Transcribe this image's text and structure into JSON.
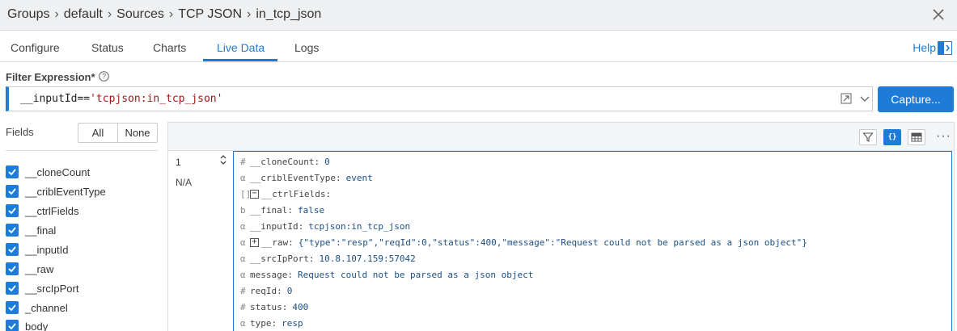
{
  "breadcrumb": [
    "Groups",
    "default",
    "Sources",
    "TCP JSON",
    "in_tcp_json"
  ],
  "tabs": [
    "Configure",
    "Status",
    "Charts",
    "Live Data",
    "Logs"
  ],
  "active_tab": "Live Data",
  "help_label": "Help",
  "filter": {
    "label": "Filter Expression*",
    "key": "__inputId==",
    "value": "'tcpjson:in_tcp_json'"
  },
  "capture_label": "Capture...",
  "fields_panel": {
    "title": "Fields",
    "all_label": "All",
    "none_label": "None",
    "items": [
      "__cloneCount",
      "__criblEventType",
      "__ctrlFields",
      "__final",
      "__inputId",
      "__raw",
      "__srcIpPort",
      "_channel",
      "body"
    ]
  },
  "event": {
    "index": "1",
    "time": "N/A",
    "fields": [
      {
        "type": "#",
        "key": "__cloneCount",
        "value": "0"
      },
      {
        "type": "α",
        "key": "__criblEventType",
        "value": "event"
      },
      {
        "type": "[]",
        "key": "__ctrlFields",
        "value": "",
        "toggle": "−"
      },
      {
        "type": "b",
        "key": "__final",
        "value": "false"
      },
      {
        "type": "α",
        "key": "__inputId",
        "value": "tcpjson:in_tcp_json"
      },
      {
        "type": "α",
        "key": "__raw",
        "value": "{\"type\":\"resp\",\"reqId\":0,\"status\":400,\"message\":\"Request could not be parsed as a json object\"}",
        "toggle": "+"
      },
      {
        "type": "α",
        "key": "__srcIpPort",
        "value": "10.8.107.159:57042"
      },
      {
        "type": "α",
        "key": "message",
        "value": "Request could not be parsed as a json object"
      },
      {
        "type": "#",
        "key": "reqId",
        "value": "0"
      },
      {
        "type": "#",
        "key": "status",
        "value": "400"
      },
      {
        "type": "α",
        "key": "type",
        "value": "resp"
      }
    ]
  },
  "colors": {
    "accent": "#1e7bd8",
    "header_bg": "#eef0f2",
    "value_text": "#1a4f86"
  }
}
